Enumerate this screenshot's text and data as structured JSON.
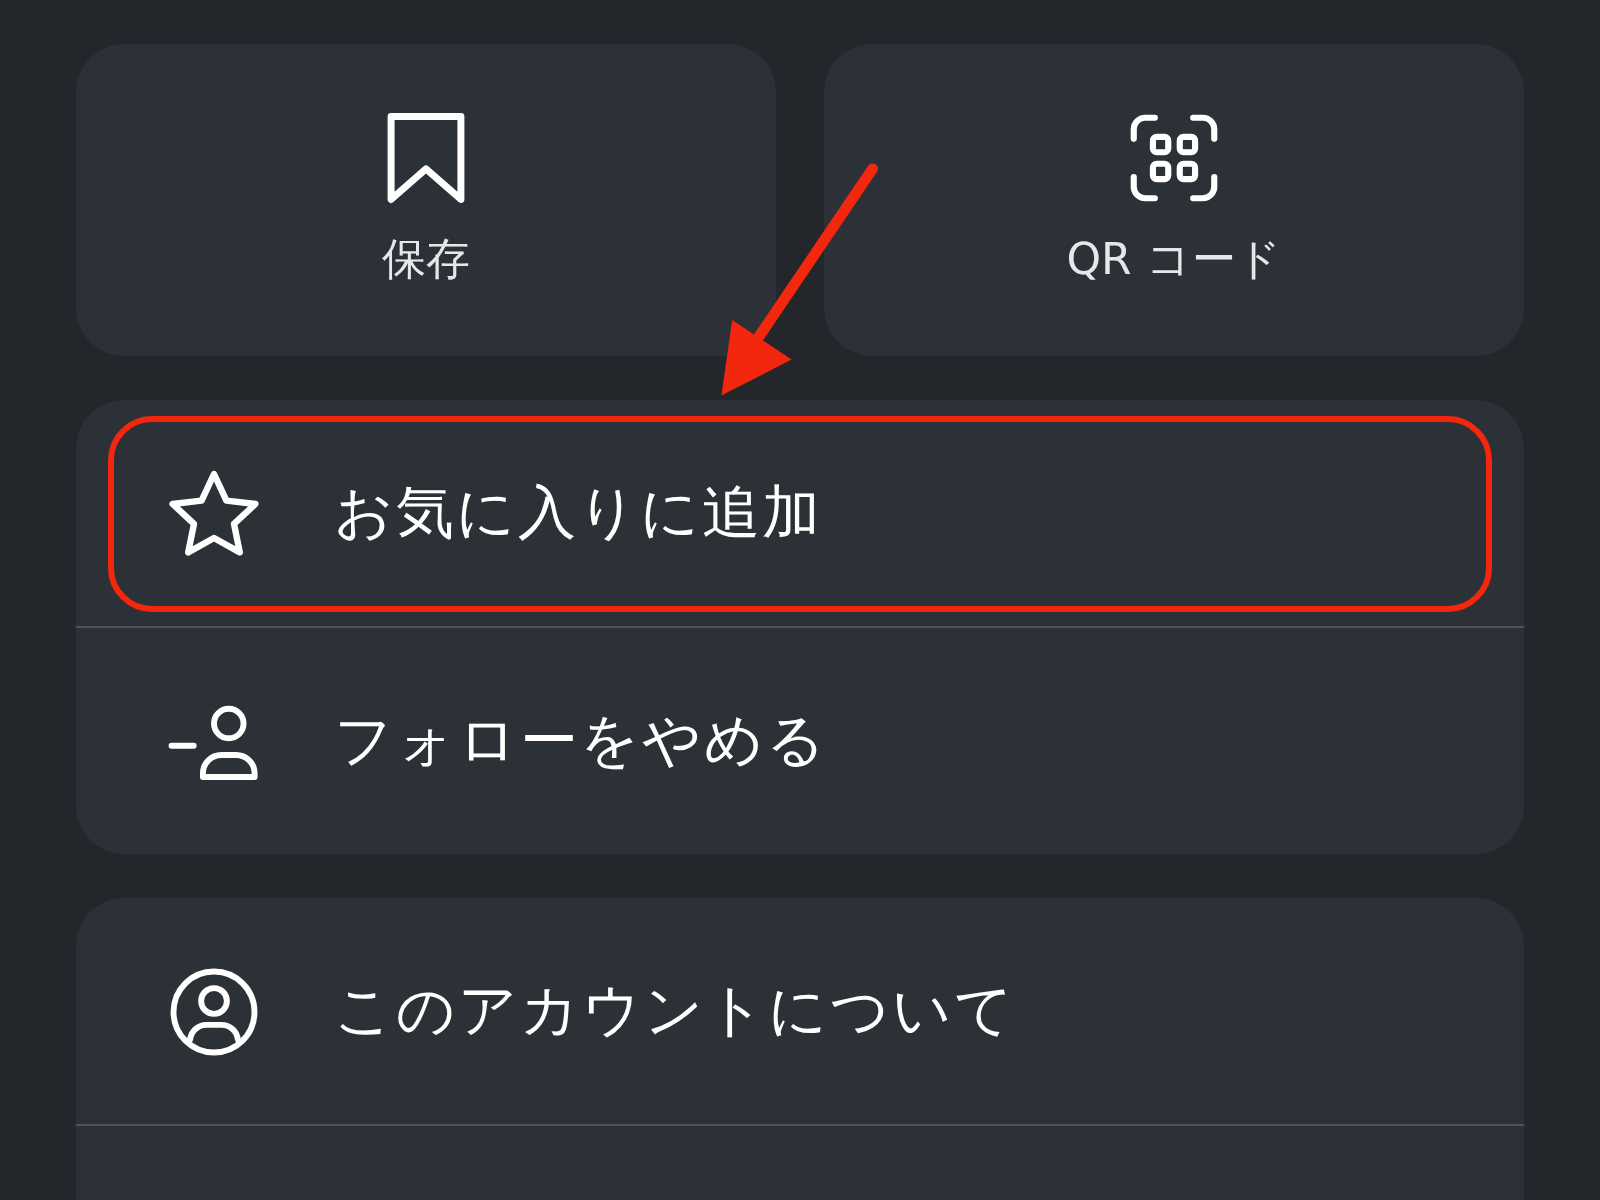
{
  "tiles": [
    {
      "kind": "bookmark",
      "label": "保存"
    },
    {
      "kind": "qr",
      "label": "QR コード"
    }
  ],
  "groups": [
    {
      "items": [
        {
          "kind": "star",
          "label": "お気に入りに追加",
          "highlighted": true
        },
        {
          "kind": "unfollow",
          "label": "フォローをやめる",
          "highlighted": false
        }
      ]
    },
    {
      "items": [
        {
          "kind": "account",
          "label": "このアカウントについて",
          "highlighted": false
        }
      ]
    }
  ]
}
